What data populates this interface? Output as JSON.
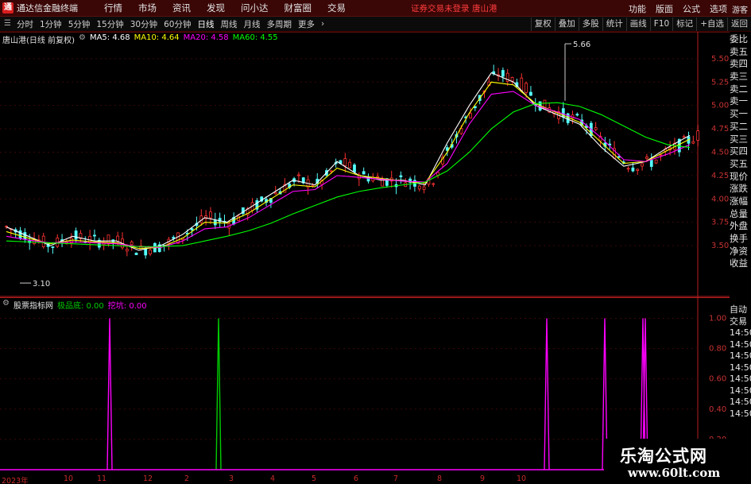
{
  "app": {
    "logo": "通",
    "title": "通达信金融终端",
    "menus": [
      "行情",
      "市场",
      "资讯",
      "发现",
      "问小达",
      "财富圈",
      "交易"
    ],
    "login_status": "证券交易未登录",
    "stock_name": "唐山港",
    "right_menus": [
      "功能",
      "版面",
      "公式",
      "选项"
    ],
    "visitor": "游客"
  },
  "toolbar": {
    "periods": [
      "分时",
      "1分钟",
      "5分钟",
      "15分钟",
      "30分钟",
      "60分钟",
      "日线",
      "周线",
      "月线",
      "多周期",
      "更多"
    ],
    "active_period": "日线",
    "right_buttons": [
      "复权",
      "叠加",
      "多股",
      "统计",
      "画线",
      "F10",
      "标记",
      "+自选",
      "返回"
    ]
  },
  "chart_header": {
    "title": "唐山港(日线 前复权)",
    "ma5_label": "MA5: 4.68",
    "ma10_label": "MA10: 4.64",
    "ma20_label": "MA20: 4.58",
    "ma60_label": "MA60: 4.55"
  },
  "colors": {
    "up": "#ff3232",
    "down": "#54fcfc",
    "ma5": "#ffffff",
    "ma10": "#ffff00",
    "ma20": "#ff00ff",
    "ma60": "#00ff00",
    "indicator_a": "#ff00ff",
    "indicator_b": "#00cc00",
    "axis": "#b41e1e"
  },
  "right_panel": {
    "labels": [
      "委比",
      "卖五",
      "卖四",
      "卖三",
      "卖二",
      "卖一",
      "买一",
      "买二",
      "买三",
      "买四",
      "买五",
      "现价",
      "涨跌",
      "涨幅",
      "总量",
      "外盘",
      "换手",
      "净资",
      "收益"
    ],
    "indicator_labels": [
      "自动",
      "交易",
      "14:50",
      "14:50",
      "14:50",
      "14:50",
      "14:50",
      "14:50",
      "14:50",
      "14:50"
    ]
  },
  "indicator_header": {
    "name": "股票指标网",
    "line1_label": "极品底: 0.00",
    "line2_label": "挖坑: 0.00"
  },
  "main_axis": {
    "labels": [
      "5.50",
      "5.25",
      "5.00",
      "4.75",
      "4.50",
      "4.25",
      "4.00",
      "3.75",
      "3.50"
    ]
  },
  "ind_axis": {
    "labels": [
      "1.00",
      "0.80",
      "0.60",
      "0.40",
      "0.20"
    ]
  },
  "annotations": {
    "high": "5.66",
    "low": "3.10"
  },
  "x_axis": {
    "labels": [
      "2023年",
      "10",
      "11",
      "12",
      "2",
      "3",
      "4",
      "5",
      "6",
      "7",
      "8",
      "9",
      "10"
    ]
  },
  "chart_data": [
    {
      "type": "line",
      "title": "唐山港(日线 前复权)",
      "xlabel": "",
      "ylabel": "",
      "ylim": [
        3.05,
        5.72
      ],
      "x": [
        "2023年",
        "10",
        "11",
        "12",
        "2",
        "3",
        "4",
        "5",
        "6",
        "7",
        "8",
        "9",
        "10"
      ],
      "series": [
        {
          "name": "MA5",
          "values": [
            3.7,
            3.6,
            3.5,
            3.6,
            3.55,
            3.55,
            3.45,
            3.5,
            3.62,
            3.8,
            3.75,
            3.9,
            4.05,
            4.2,
            4.15,
            4.4,
            4.25,
            4.2,
            4.2,
            4.15,
            4.6,
            5.0,
            5.35,
            5.25,
            5.0,
            4.9,
            4.8,
            4.55,
            4.35,
            4.4,
            4.55,
            4.68
          ]
        },
        {
          "name": "MA10",
          "values": [
            3.65,
            3.58,
            3.52,
            3.56,
            3.54,
            3.53,
            3.47,
            3.48,
            3.58,
            3.75,
            3.74,
            3.85,
            4.0,
            4.15,
            4.13,
            4.33,
            4.25,
            4.22,
            4.19,
            4.17,
            4.5,
            4.92,
            5.25,
            5.22,
            5.02,
            4.92,
            4.82,
            4.6,
            4.38,
            4.4,
            4.52,
            4.64
          ]
        },
        {
          "name": "MA20",
          "values": [
            3.6,
            3.56,
            3.53,
            3.54,
            3.53,
            3.52,
            3.49,
            3.48,
            3.55,
            3.68,
            3.7,
            3.8,
            3.94,
            4.08,
            4.1,
            4.25,
            4.23,
            4.21,
            4.19,
            4.18,
            4.38,
            4.8,
            5.12,
            5.15,
            5.0,
            4.93,
            4.85,
            4.65,
            4.42,
            4.4,
            4.48,
            4.58
          ]
        },
        {
          "name": "MA60",
          "values": [
            3.55,
            3.54,
            3.53,
            3.52,
            3.51,
            3.5,
            3.49,
            3.49,
            3.5,
            3.55,
            3.6,
            3.66,
            3.74,
            3.84,
            3.93,
            4.02,
            4.08,
            4.12,
            4.15,
            4.18,
            4.3,
            4.5,
            4.75,
            4.93,
            5.02,
            5.03,
            4.99,
            4.9,
            4.78,
            4.66,
            4.58,
            4.55
          ]
        }
      ],
      "annotations": [
        {
          "label": "5.66",
          "value": 5.66
        },
        {
          "label": "3.10",
          "value": 3.1
        }
      ]
    },
    {
      "type": "line",
      "title": "股票指标网",
      "ylim": [
        0,
        1.05
      ],
      "series": [
        {
          "name": "极品底",
          "values": [
            0,
            0,
            0,
            0,
            0,
            0,
            0,
            1.0,
            0,
            0,
            0,
            0,
            0,
            0,
            0,
            0,
            0,
            0,
            0,
            0,
            0,
            0,
            0,
            0,
            0,
            0,
            0,
            0,
            0,
            0,
            0,
            0
          ],
          "color": "#ff00ff"
        },
        {
          "name": "挖坑",
          "values": [
            0,
            0,
            0,
            0,
            0,
            0,
            0,
            0,
            0,
            0,
            0,
            0,
            0,
            0,
            1.0,
            0,
            0,
            0,
            0,
            0,
            0,
            0,
            0,
            0,
            0,
            0,
            0,
            0,
            0,
            0,
            0,
            0
          ],
          "color": "#00cc00"
        }
      ]
    }
  ]
}
